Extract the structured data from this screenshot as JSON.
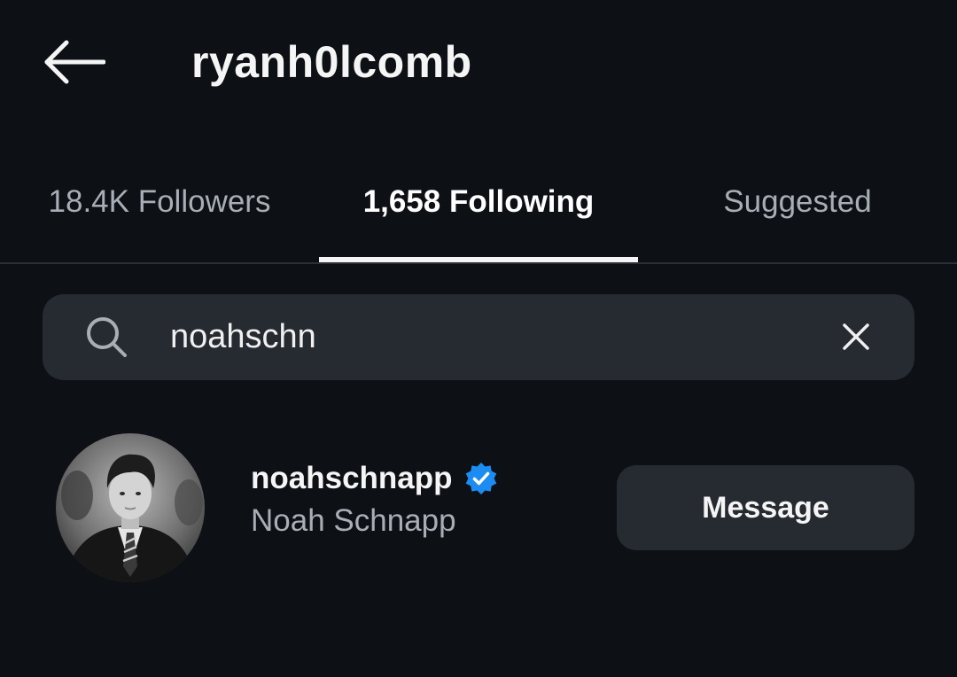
{
  "header": {
    "title": "ryanh0lcomb",
    "back_icon": "arrow-left-icon"
  },
  "tabs": [
    {
      "label": "18.4K Followers",
      "active": false
    },
    {
      "label": "1,658 Following",
      "active": true
    },
    {
      "label": "Suggested",
      "active": false
    }
  ],
  "search": {
    "value": "noahschn",
    "placeholder": "Search",
    "search_icon": "search-icon",
    "clear_icon": "close-icon"
  },
  "results": [
    {
      "username": "noahschnapp",
      "display_name": "Noah Schnapp",
      "verified": true,
      "button_label": "Message"
    }
  ],
  "colors": {
    "background": "#0d1015",
    "surface": "#262a31",
    "verified": "#1d8cf2",
    "muted_text": "#a8aeb6"
  }
}
